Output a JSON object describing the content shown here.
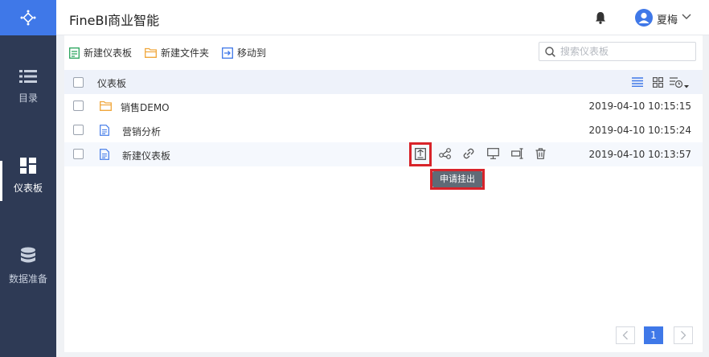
{
  "app": {
    "title": "FineBI商业智能"
  },
  "sidebar": {
    "items": [
      {
        "label": "目录",
        "icon": "list-icon"
      },
      {
        "label": "仪表板",
        "icon": "dashboard-grid-icon",
        "active": true
      },
      {
        "label": "数据准备",
        "icon": "database-icon"
      }
    ]
  },
  "user": {
    "name": "夏梅"
  },
  "toolbar": {
    "new_dashboard": "新建仪表板",
    "new_folder": "新建文件夹",
    "move_to": "移动到"
  },
  "search": {
    "placeholder": "搜索仪表板"
  },
  "list": {
    "header": "仪表板",
    "rows": [
      {
        "name": "销售DEMO",
        "type": "folder",
        "date": "2019-04-10 10:15:15"
      },
      {
        "name": "营销分析",
        "type": "dashboard",
        "date": "2019-04-10 10:15:24"
      },
      {
        "name": "新建仪表板",
        "type": "dashboard",
        "date": "2019-04-10 10:13:57"
      }
    ]
  },
  "row_actions": [
    "request-mount-icon",
    "share-icon",
    "link-icon",
    "present-icon",
    "rename-icon",
    "delete-icon"
  ],
  "tooltip": {
    "text": "申请挂出"
  },
  "pagination": {
    "current": "1"
  },
  "colors": {
    "accent": "#3f78e8",
    "sidebar": "#2e3a55",
    "highlight": "#d8232a",
    "folder": "#f0a63a"
  }
}
